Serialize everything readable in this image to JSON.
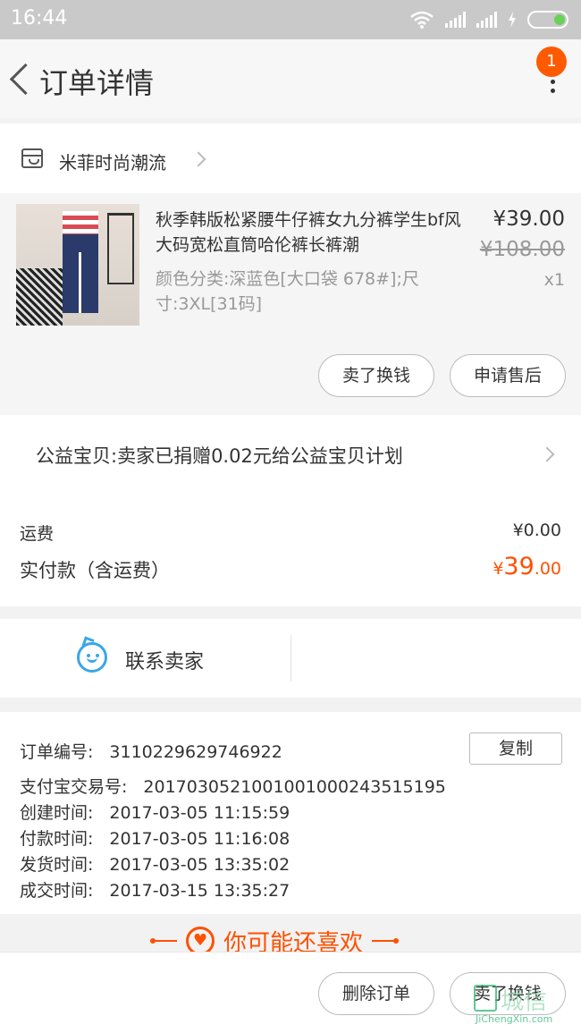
{
  "status_bar": {
    "time": "16:44"
  },
  "header": {
    "title": "订单详情",
    "notification_count": "1"
  },
  "shop": {
    "name": "米菲时尚潮流"
  },
  "product": {
    "title": "秋季韩版松紧腰牛仔裤女九分裤学生bf风大码宽松直筒哈伦裤长裤潮",
    "spec": "颜色分类:深蓝色[大口袋 678#];尺寸:3XL[31码]",
    "price": "¥39.00",
    "original_price": "¥108.00",
    "quantity": "x1",
    "buttons": {
      "sell": "卖了换钱",
      "after_sale": "申请售后"
    }
  },
  "charity": {
    "text": "公益宝贝:卖家已捐赠0.02元给公益宝贝计划"
  },
  "fees": {
    "shipping_label": "运费",
    "shipping_value": "¥0.00",
    "paid_label": "实付款（含运费）",
    "paid_symbol": "¥",
    "paid_int": "39",
    "paid_dec": ".00"
  },
  "contact": {
    "label": "联系卖家"
  },
  "order_info": {
    "copy_label": "复制",
    "rows": [
      {
        "label": "订单编号:",
        "value": "3110229629746922"
      },
      {
        "label": "支付宝交易号:",
        "value": "2017030521001001000243515195"
      },
      {
        "label": "创建时间:",
        "value": "2017-03-05 11:15:59"
      },
      {
        "label": "付款时间:",
        "value": "2017-03-05 11:16:08"
      },
      {
        "label": "发货时间:",
        "value": "2017-03-05 13:35:02"
      },
      {
        "label": "成交时间:",
        "value": "2017-03-15 13:35:27"
      }
    ]
  },
  "recommend": {
    "title": "你可能还喜欢"
  },
  "bottom_bar": {
    "delete_label": "删除订单",
    "sell_label": "卖了换钱"
  },
  "watermark": {
    "text": "城信",
    "sub": "JiChengXin.com"
  },
  "colors": {
    "accent": "#ff5000",
    "contact_blue": "#3aa6e8",
    "badge": "#ff5a00"
  }
}
